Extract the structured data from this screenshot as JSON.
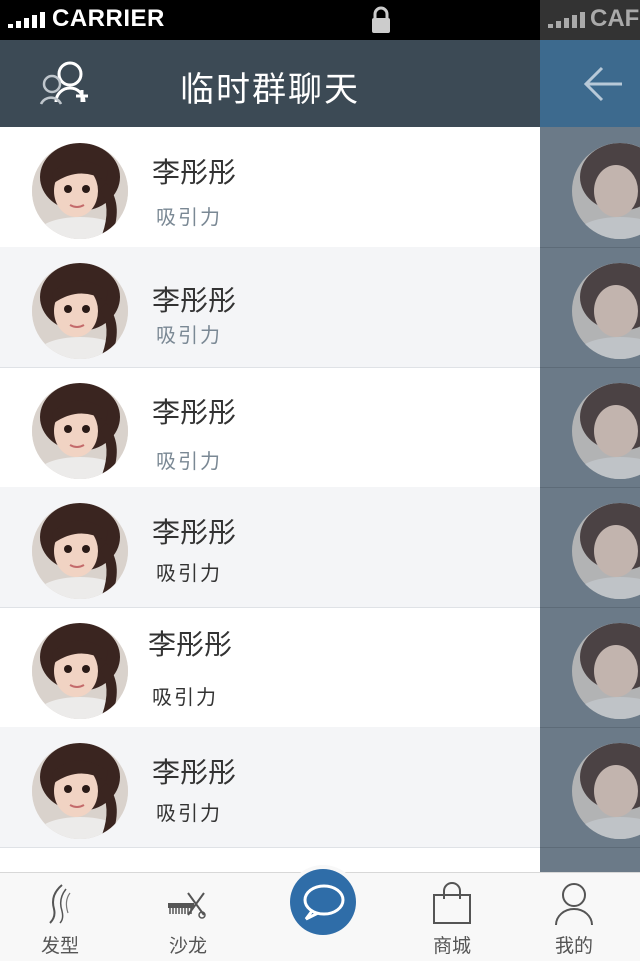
{
  "status_bar": {
    "carrier": "CARRIER",
    "carrier_right": "CAF"
  },
  "nav": {
    "title": "临时群聊天"
  },
  "contacts": [
    {
      "name": "李彤彤",
      "subtitle": "吸引力"
    },
    {
      "name": "李彤彤",
      "subtitle": "吸引力"
    },
    {
      "name": "李彤彤",
      "subtitle": "吸引力"
    },
    {
      "name": "李彤彤",
      "subtitle": "吸引力"
    },
    {
      "name": "李彤彤",
      "subtitle": "吸引力"
    },
    {
      "name": "李彤彤",
      "subtitle": "吸引力"
    }
  ],
  "tabs": [
    {
      "label": "发型",
      "icon": "hairstyle-icon"
    },
    {
      "label": "沙龙",
      "icon": "comb-scissors-icon"
    },
    {
      "label": "",
      "icon": "chat-bubble-icon"
    },
    {
      "label": "商城",
      "icon": "shopping-bag-icon"
    },
    {
      "label": "我的",
      "icon": "user-icon"
    }
  ],
  "colors": {
    "navbar": "#3c4a55",
    "accent": "#2f6da8",
    "overlay_header": "#3d6a8e"
  }
}
